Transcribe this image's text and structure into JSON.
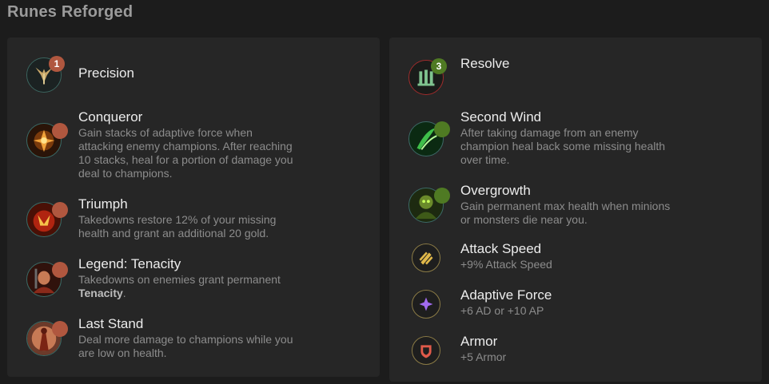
{
  "page": {
    "title": "Runes Reforged"
  },
  "colors": {
    "precision_accent": "#b0573f",
    "resolve_accent": "#4f7a23",
    "panel_bg": "#262626",
    "page_bg": "#1c1c1c"
  },
  "primary": {
    "tree_name": "Precision",
    "badge": "1",
    "icon": "precision-icon",
    "runes": [
      {
        "name": "Conqueror",
        "desc": "Gain stacks of adaptive force when attacking enemy champions. After reaching 10 stacks, heal for a portion of damage you deal to champions.",
        "icon": "conqueror-icon"
      },
      {
        "name": "Triumph",
        "desc": "Takedowns restore 12% of your missing health and grant an additional 20 gold.",
        "icon": "triumph-icon"
      },
      {
        "name": "Legend: Tenacity",
        "desc_pre": "Takedowns on enemies grant permanent",
        "desc_bold": "Tenacity",
        "desc_post": ".",
        "icon": "legend-tenacity-icon"
      },
      {
        "name": "Last Stand",
        "desc": "Deal more damage to champions while you are low on health.",
        "icon": "last-stand-icon"
      }
    ]
  },
  "secondary": {
    "tree_name": "Resolve",
    "badge": "3",
    "icon": "resolve-icon",
    "runes": [
      {
        "name": "Second Wind",
        "desc": "After taking damage from an enemy champion heal back some missing health over time.",
        "icon": "second-wind-icon"
      },
      {
        "name": "Overgrowth",
        "desc": "Gain permanent max health when minions or monsters die near you.",
        "icon": "overgrowth-icon"
      }
    ]
  },
  "shards": [
    {
      "name": "Attack Speed",
      "desc": "+9% Attack Speed",
      "icon": "attack-speed-icon"
    },
    {
      "name": "Adaptive Force",
      "desc": "+6 AD or +10 AP",
      "icon": "adaptive-force-icon"
    },
    {
      "name": "Armor",
      "desc": "+5 Armor",
      "icon": "armor-icon"
    }
  ]
}
